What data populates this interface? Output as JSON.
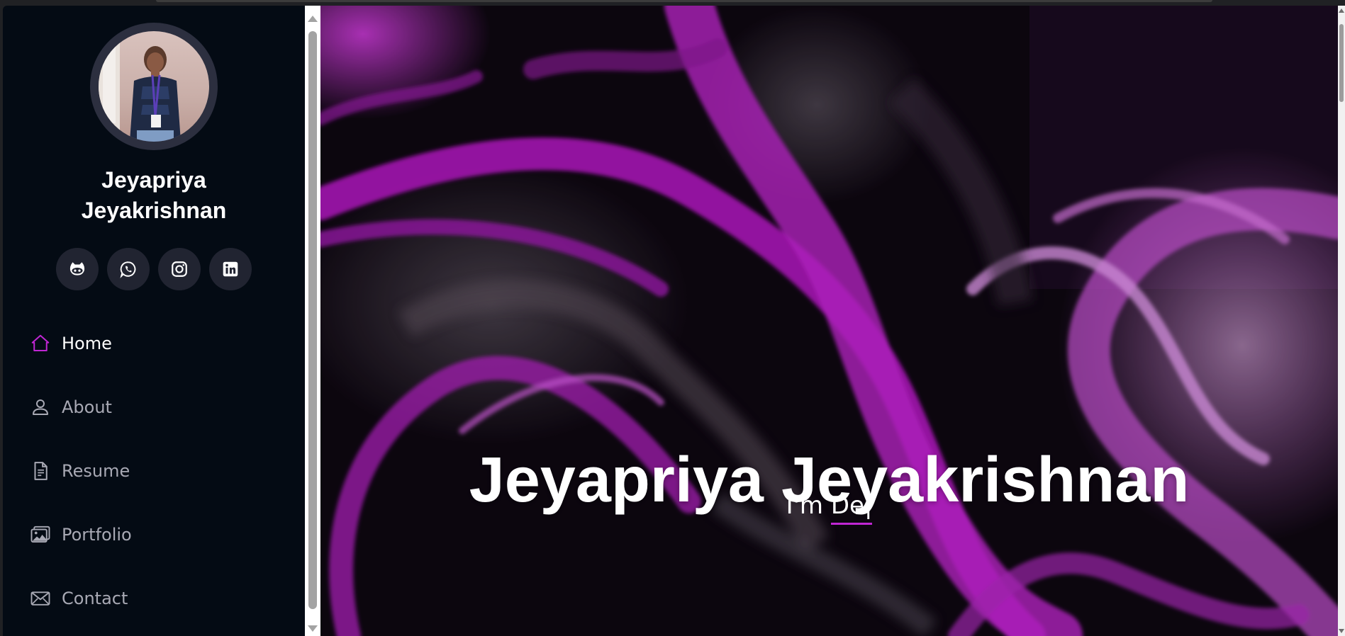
{
  "profile": {
    "name_line1": "Jeyapriya",
    "name_line2": "Jeyakrishnan"
  },
  "socials": [
    {
      "icon": "github-icon"
    },
    {
      "icon": "whatsapp-icon"
    },
    {
      "icon": "instagram-icon"
    },
    {
      "icon": "linkedin-icon"
    }
  ],
  "nav": {
    "items": [
      {
        "label": "Home",
        "icon": "home-icon",
        "active": true
      },
      {
        "label": "About",
        "icon": "person-icon",
        "active": false
      },
      {
        "label": "Resume",
        "icon": "file-text-icon",
        "active": false
      },
      {
        "label": "Portfolio",
        "icon": "images-icon",
        "active": false
      },
      {
        "label": "Contact",
        "icon": "envelope-icon",
        "active": false
      }
    ]
  },
  "hero": {
    "title": "Jeyapriya Jeyakrishnan",
    "subtitle_prefix": "I'm ",
    "typed_text": "De|"
  },
  "colors": {
    "accent": "#c026d3",
    "sidebar_bg": "#040b14",
    "social_bg": "#212431",
    "nav_text": "#a8a9b4"
  }
}
